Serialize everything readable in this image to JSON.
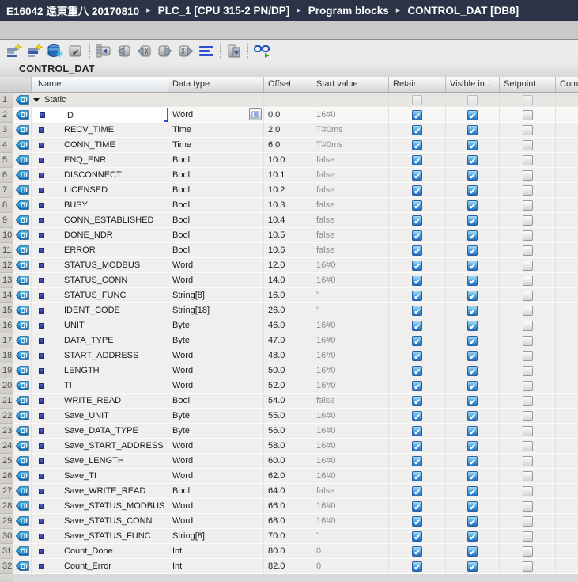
{
  "breadcrumb": {
    "items": [
      "E16042 遠東重八 20170810",
      "PLC_1 [CPU 315-2 PN/DP]",
      "Program blocks",
      "CONTROL_DAT [DB8]"
    ],
    "separator": "▸"
  },
  "toolbar": {
    "icons": [
      "insert-row",
      "add-row",
      "keep-actual-values",
      "snapshot-actual-values",
      "copy-snapshots-to-start-values",
      "copy-left",
      "copy-left-all",
      "copy-right",
      "copy-right-all",
      "expand-rows",
      "download-without-reinit",
      "monitor-all"
    ]
  },
  "title": "CONTROL_DAT",
  "table": {
    "columns": [
      "Name",
      "Data type",
      "Offset",
      "Start value",
      "Retain",
      "Visible in ...",
      "Setpoint",
      "Com"
    ],
    "rows": [
      {
        "num": "1",
        "kind": "group",
        "name": "Static",
        "retain": false,
        "visible": false,
        "setpoint": false
      },
      {
        "num": "2",
        "name": "ID",
        "type": "Word",
        "offset": "0.0",
        "start": "16#0",
        "retain": true,
        "visible": true,
        "setpoint": false,
        "selected": true
      },
      {
        "num": "3",
        "name": "RECV_TIME",
        "type": "Time",
        "offset": "2.0",
        "start": "T#0ms",
        "retain": true,
        "visible": true,
        "setpoint": false
      },
      {
        "num": "4",
        "name": "CONN_TIME",
        "type": "Time",
        "offset": "6.0",
        "start": "T#0ms",
        "retain": true,
        "visible": true,
        "setpoint": false
      },
      {
        "num": "5",
        "name": "ENQ_ENR",
        "type": "Bool",
        "offset": "10.0",
        "start": "false",
        "retain": true,
        "visible": true,
        "setpoint": false
      },
      {
        "num": "6",
        "name": "DISCONNECT",
        "type": "Bool",
        "offset": "10.1",
        "start": "false",
        "retain": true,
        "visible": true,
        "setpoint": false
      },
      {
        "num": "7",
        "name": "LICENSED",
        "type": "Bool",
        "offset": "10.2",
        "start": "false",
        "retain": true,
        "visible": true,
        "setpoint": false
      },
      {
        "num": "8",
        "name": "BUSY",
        "type": "Bool",
        "offset": "10.3",
        "start": "false",
        "retain": true,
        "visible": true,
        "setpoint": false
      },
      {
        "num": "9",
        "name": "CONN_ESTABLISHED",
        "type": "Bool",
        "offset": "10.4",
        "start": "false",
        "retain": true,
        "visible": true,
        "setpoint": false
      },
      {
        "num": "10",
        "name": "DONE_NDR",
        "type": "Bool",
        "offset": "10.5",
        "start": "false",
        "retain": true,
        "visible": true,
        "setpoint": false
      },
      {
        "num": "11",
        "name": "ERROR",
        "type": "Bool",
        "offset": "10.6",
        "start": "false",
        "retain": true,
        "visible": true,
        "setpoint": false
      },
      {
        "num": "12",
        "name": "STATUS_MODBUS",
        "type": "Word",
        "offset": "12.0",
        "start": "16#0",
        "retain": true,
        "visible": true,
        "setpoint": false
      },
      {
        "num": "13",
        "name": "STATUS_CONN",
        "type": "Word",
        "offset": "14.0",
        "start": "16#0",
        "retain": true,
        "visible": true,
        "setpoint": false
      },
      {
        "num": "14",
        "name": "STATUS_FUNC",
        "type": "String[8]",
        "offset": "16.0",
        "start": "''",
        "retain": true,
        "visible": true,
        "setpoint": false
      },
      {
        "num": "15",
        "name": "IDENT_CODE",
        "type": "String[18]",
        "offset": "26.0",
        "start": "''",
        "retain": true,
        "visible": true,
        "setpoint": false
      },
      {
        "num": "16",
        "name": "UNIT",
        "type": "Byte",
        "offset": "46.0",
        "start": "16#0",
        "retain": true,
        "visible": true,
        "setpoint": false
      },
      {
        "num": "17",
        "name": "DATA_TYPE",
        "type": "Byte",
        "offset": "47.0",
        "start": "16#0",
        "retain": true,
        "visible": true,
        "setpoint": false
      },
      {
        "num": "18",
        "name": "START_ADDRESS",
        "type": "Word",
        "offset": "48.0",
        "start": "16#0",
        "retain": true,
        "visible": true,
        "setpoint": false
      },
      {
        "num": "19",
        "name": "LENGTH",
        "type": "Word",
        "offset": "50.0",
        "start": "16#0",
        "retain": true,
        "visible": true,
        "setpoint": false
      },
      {
        "num": "20",
        "name": "TI",
        "type": "Word",
        "offset": "52.0",
        "start": "16#0",
        "retain": true,
        "visible": true,
        "setpoint": false
      },
      {
        "num": "21",
        "name": "WRITE_READ",
        "type": "Bool",
        "offset": "54.0",
        "start": "false",
        "retain": true,
        "visible": true,
        "setpoint": false
      },
      {
        "num": "22",
        "name": "Save_UNIT",
        "type": "Byte",
        "offset": "55.0",
        "start": "16#0",
        "retain": true,
        "visible": true,
        "setpoint": false
      },
      {
        "num": "23",
        "name": "Save_DATA_TYPE",
        "type": "Byte",
        "offset": "56.0",
        "start": "16#0",
        "retain": true,
        "visible": true,
        "setpoint": false
      },
      {
        "num": "24",
        "name": "Save_START_ADDRESS",
        "type": "Word",
        "offset": "58.0",
        "start": "16#0",
        "retain": true,
        "visible": true,
        "setpoint": false
      },
      {
        "num": "25",
        "name": "Save_LENGTH",
        "type": "Word",
        "offset": "60.0",
        "start": "16#0",
        "retain": true,
        "visible": true,
        "setpoint": false
      },
      {
        "num": "26",
        "name": "Save_TI",
        "type": "Word",
        "offset": "62.0",
        "start": "16#0",
        "retain": true,
        "visible": true,
        "setpoint": false
      },
      {
        "num": "27",
        "name": "Save_WRITE_READ",
        "type": "Bool",
        "offset": "64.0",
        "start": "false",
        "retain": true,
        "visible": true,
        "setpoint": false
      },
      {
        "num": "28",
        "name": "Save_STATUS_MODBUS",
        "type": "Word",
        "offset": "66.0",
        "start": "16#0",
        "retain": true,
        "visible": true,
        "setpoint": false
      },
      {
        "num": "29",
        "name": "Save_STATUS_CONN",
        "type": "Word",
        "offset": "68.0",
        "start": "16#0",
        "retain": true,
        "visible": true,
        "setpoint": false
      },
      {
        "num": "30",
        "name": "Save_STATUS_FUNC",
        "type": "String[8]",
        "offset": "70.0",
        "start": "''",
        "retain": true,
        "visible": true,
        "setpoint": false
      },
      {
        "num": "31",
        "name": "Count_Done",
        "type": "Int",
        "offset": "80.0",
        "start": "0",
        "retain": true,
        "visible": true,
        "setpoint": false
      },
      {
        "num": "32",
        "name": "Count_Error",
        "type": "Int",
        "offset": "82.0",
        "start": "0",
        "retain": true,
        "visible": true,
        "setpoint": false
      }
    ]
  }
}
